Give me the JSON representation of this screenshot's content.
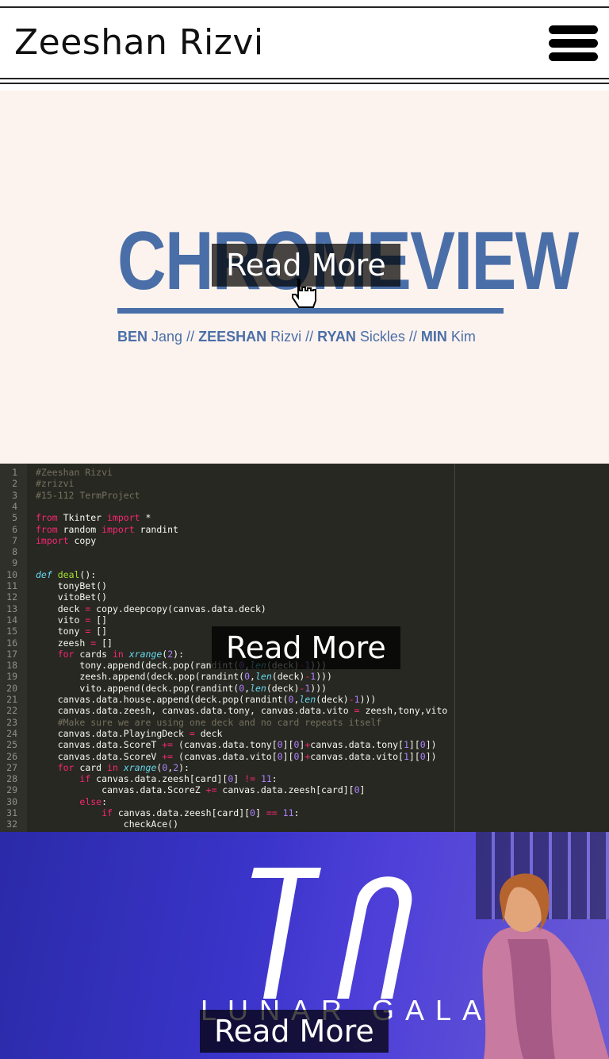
{
  "header": {
    "title": "Zeeshan Rizvi",
    "menu_icon": "hamburger-icon"
  },
  "projects": [
    {
      "name": "chromeview",
      "read_more": "Read More",
      "title": "CHROMEVIEW",
      "credits": [
        {
          "first": "BEN",
          "last": "Jang"
        },
        {
          "first": "ZEESHAN",
          "last": "Rizvi"
        },
        {
          "first": "RYAN",
          "last": "Sickles"
        },
        {
          "first": "MIN",
          "last": "Kim"
        }
      ],
      "accent": "#4a6fa8"
    },
    {
      "name": "term-project",
      "read_more": "Read More"
    },
    {
      "name": "lunar-gala",
      "read_more": "Read More",
      "subtitle": "LUNAR GALA"
    }
  ],
  "code_lines": [
    "#Zeeshan Rizvi",
    "#zrizvi",
    "#15-112 TermProject",
    "",
    "from Tkinter import *",
    "from random import randint",
    "import copy",
    "",
    "",
    "def deal():",
    "    tonyBet()",
    "    vitoBet()",
    "    deck = copy.deepcopy(canvas.data.deck)",
    "    vito = []",
    "    tony = []",
    "    zeesh = []",
    "    for cards in xrange(2):",
    "        tony.append(deck.pop(randint(0,len(deck)-1)))",
    "        zeesh.append(deck.pop(randint(0,len(deck)-1)))",
    "        vito.append(deck.pop(randint(0,len(deck)-1)))",
    "    canvas.data.house.append(deck.pop(randint(0,len(deck)-1)))",
    "    canvas.data.zeesh, canvas.data.tony, canvas.data.vito = zeesh,tony,vito",
    "    #Make sure we are using one deck and no card repeats itself",
    "    canvas.data.PlayingDeck = deck",
    "    canvas.data.ScoreT += (canvas.data.tony[0][0]+canvas.data.tony[1][0])",
    "    canvas.data.ScoreV += (canvas.data.vito[0][0]+canvas.data.vito[1][0])",
    "    for card in xrange(0,2):",
    "        if canvas.data.zeesh[card][0] != 11:",
    "            canvas.data.ScoreZ += canvas.data.zeesh[card][0]",
    "        else:",
    "            if canvas.data.zeesh[card][0] == 11:",
    "                checkAce()"
  ]
}
